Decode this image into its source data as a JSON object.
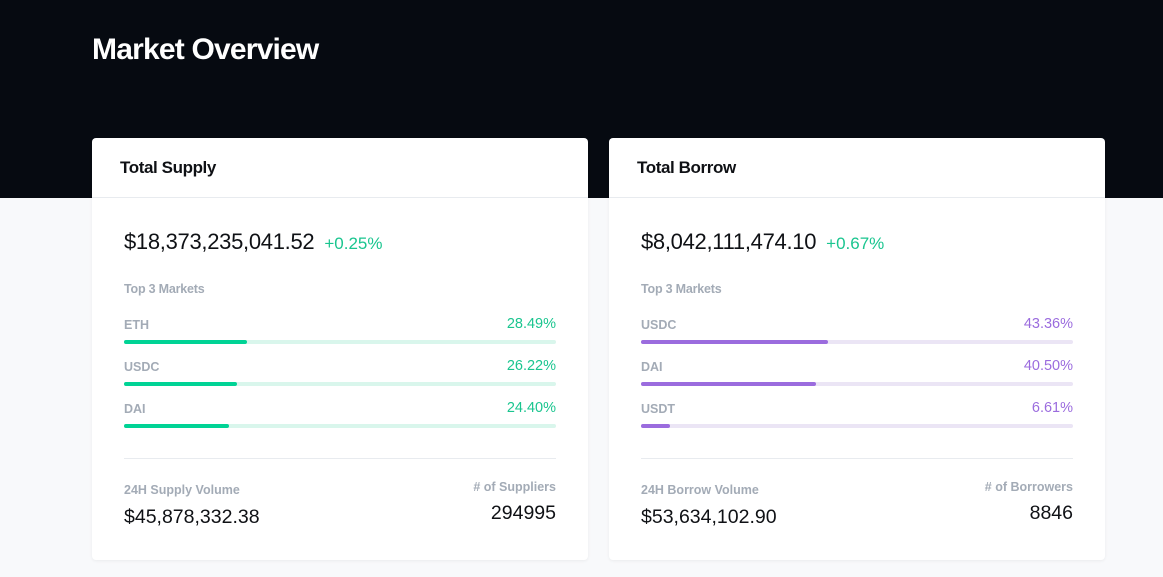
{
  "page": {
    "title": "Market Overview"
  },
  "supply": {
    "title": "Total Supply",
    "total": "$18,373,235,041.52",
    "change": "+0.25%",
    "top_label": "Top 3 Markets",
    "markets": [
      {
        "name": "ETH",
        "pct": "28.49%",
        "fraction": 0.2849
      },
      {
        "name": "USDC",
        "pct": "26.22%",
        "fraction": 0.2622
      },
      {
        "name": "DAI",
        "pct": "24.40%",
        "fraction": 0.244
      }
    ],
    "volume_label": "24H Supply Volume",
    "volume": "$45,878,332.38",
    "count_label": "# of Suppliers",
    "count": "294995"
  },
  "borrow": {
    "title": "Total Borrow",
    "total": "$8,042,111,474.10",
    "change": "+0.67%",
    "top_label": "Top 3 Markets",
    "markets": [
      {
        "name": "USDC",
        "pct": "43.36%",
        "fraction": 0.4336
      },
      {
        "name": "DAI",
        "pct": "40.50%",
        "fraction": 0.405
      },
      {
        "name": "USDT",
        "pct": "6.61%",
        "fraction": 0.0661
      }
    ],
    "volume_label": "24H Borrow Volume",
    "volume": "$53,634,102.90",
    "count_label": "# of Borrowers",
    "count": "8846"
  },
  "colors": {
    "hero_bg": "#060a11",
    "supply_accent": "#00d395",
    "borrow_accent": "#9b6cde"
  }
}
